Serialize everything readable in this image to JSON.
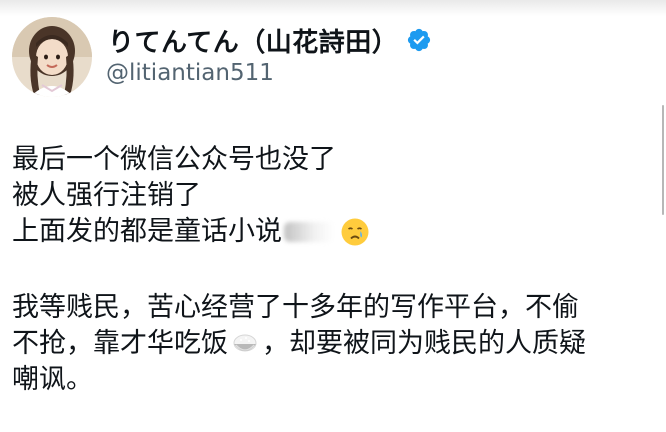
{
  "profile": {
    "display_name": "りてんてん（山花詩田）",
    "handle": "@litiantian511",
    "verified": true,
    "avatar_icon": "profile-photo",
    "verified_icon": "verified-badge-icon"
  },
  "tweet": {
    "line1": "最后一个微信公众号也没了",
    "line2": "被人强行注销了",
    "line3": "上面发的都是童话小说",
    "line3_emoji": "crying-face-emoji",
    "line4": "我等贱民，苦心经营了十多年的写作平台，不偷",
    "line5a": "不抢，靠才华吃饭",
    "line5_emoji": "rice-bowl-emoji",
    "line5b": "，却要被同为贱民的人质疑",
    "line6": "嘲讽。"
  },
  "colors": {
    "text": "#0f1419",
    "handle": "#536471",
    "verified": "#1d9bf0"
  }
}
